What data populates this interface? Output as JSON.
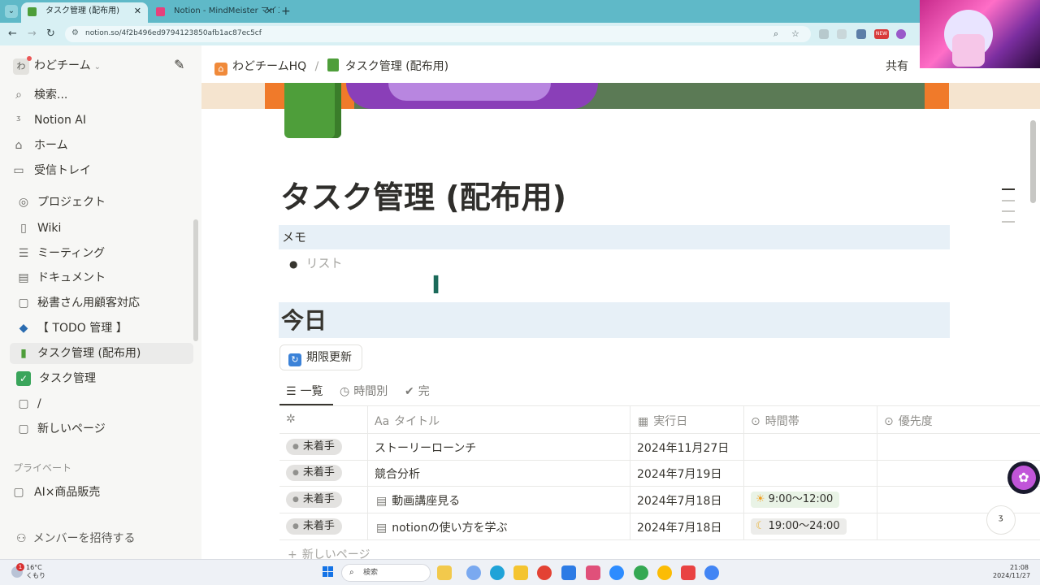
{
  "browser": {
    "tabs": [
      {
        "label": "タスク管理 (配布用)",
        "active": true
      },
      {
        "label": "Notion - MindMeister マインドマ",
        "active": false
      }
    ],
    "url": "notion.so/4f2b496ed9794123850afb1ac87ec5cf",
    "new_badge": "NEW"
  },
  "sidebar": {
    "workspace_avatar": "わ",
    "workspace_name": "わどチーム",
    "top_items": [
      {
        "label": "検索...",
        "icon": "search-icon"
      },
      {
        "label": "Notion AI",
        "icon": "notion-ai-icon"
      },
      {
        "label": "ホーム",
        "icon": "home-icon"
      },
      {
        "label": "受信トレイ",
        "icon": "inbox-icon"
      }
    ],
    "pages": [
      {
        "label": "プロジェクト",
        "icon": "target-icon"
      },
      {
        "label": "Wiki",
        "icon": "book-icon"
      },
      {
        "label": "ミーティング",
        "icon": "meeting-icon"
      },
      {
        "label": "ドキュメント",
        "icon": "document-icon"
      },
      {
        "label": "秘書さん用顧客対応",
        "icon": "page-icon"
      },
      {
        "label": "【 TODO 管理 】",
        "icon": "todo-icon"
      },
      {
        "label": "タスク管理 (配布用)",
        "icon": "green-book-icon",
        "selected": true
      },
      {
        "label": "タスク管理",
        "icon": "checkbox-icon"
      },
      {
        "label": "/",
        "icon": "page-icon"
      },
      {
        "label": "新しいページ",
        "icon": "page-icon"
      }
    ],
    "private_label": "プライベート",
    "private_pages": [
      {
        "label": "AI×商品販売",
        "icon": "page-icon"
      }
    ],
    "invite_label": "メンバーを招待する"
  },
  "topbar": {
    "breadcrumb": [
      "わどチームHQ",
      "タスク管理 (配布用)"
    ],
    "separator": "/",
    "share_label": "共有"
  },
  "page": {
    "title": "タスク管理 (配布用)",
    "memo_heading": "メモ",
    "memo_placeholder": "リスト",
    "today_heading": "今日",
    "refresh_button": "期限更新",
    "view_tabs": [
      {
        "label": "一覧",
        "active": true
      },
      {
        "label": "時間別",
        "active": false
      },
      {
        "label": "完",
        "active": false
      }
    ],
    "columns": {
      "title": "タイトル",
      "title_prefix": "Aa",
      "date": "実行日",
      "time": "時間帯",
      "priority": "優先度"
    },
    "rows": [
      {
        "status": "未着手",
        "title": "ストーリーローンチ",
        "has_doc": false,
        "date": "2024年11月27日",
        "time": ""
      },
      {
        "status": "未着手",
        "title": "競合分析",
        "has_doc": false,
        "date": "2024年7月19日",
        "time": ""
      },
      {
        "status": "未着手",
        "title": "動画講座見る",
        "has_doc": true,
        "date": "2024年7月18日",
        "time": "9:00〜12:00",
        "time_icon": "sun-icon",
        "time_color": "#e9f3e6"
      },
      {
        "status": "未着手",
        "title": "notionの使い方を学ぶ",
        "has_doc": true,
        "date": "2024年7月18日",
        "time": "19:00〜24:00",
        "time_icon": "moon-icon",
        "time_color": "#ececea"
      }
    ],
    "new_page_label": "新しいページ"
  },
  "taskbar": {
    "temperature": "16°C",
    "weather": "くもり",
    "weather_badge": "1",
    "search_label": "検索",
    "time": "21:08",
    "date": "2024/11/27"
  }
}
